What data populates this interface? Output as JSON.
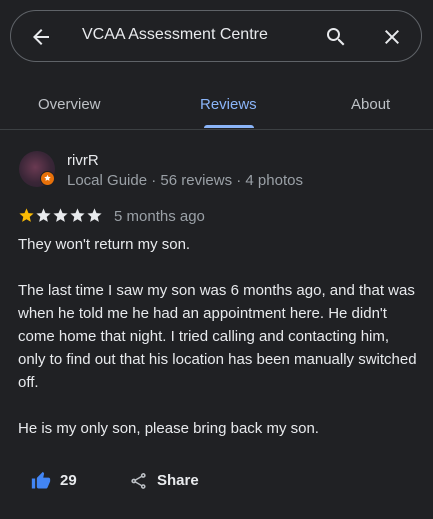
{
  "search": {
    "query": "VCAA Assessment Centre"
  },
  "tabs": [
    {
      "label": "Overview",
      "active": false
    },
    {
      "label": "Reviews",
      "active": true
    },
    {
      "label": "About",
      "active": false
    }
  ],
  "review": {
    "author": "rivrR",
    "meta": "Local Guide · 56 reviews · 4 photos",
    "rating": 1,
    "rating_max": 5,
    "date": "5 months ago",
    "paragraphs": [
      "They won't return my son.",
      "The last time I saw my son was 6 months ago, and that was when he told me he had an appointment here. He didn't come home that night. I tried calling and contacting him, only to find out that his location has been manually switched off.",
      "He is my only son, please bring back my son."
    ],
    "likes": "29",
    "share_label": "Share"
  },
  "colors": {
    "background": "#202124",
    "accent": "#8ab4f8",
    "star_filled": "#fbbc04",
    "star_empty": "#e8eaed",
    "like_icon": "#4285f4"
  },
  "icons": {
    "back": "arrow-left-icon",
    "search": "search-icon",
    "close": "close-icon",
    "like": "thumbs-up-icon",
    "share": "share-icon",
    "badge": "local-guide-badge-icon"
  }
}
